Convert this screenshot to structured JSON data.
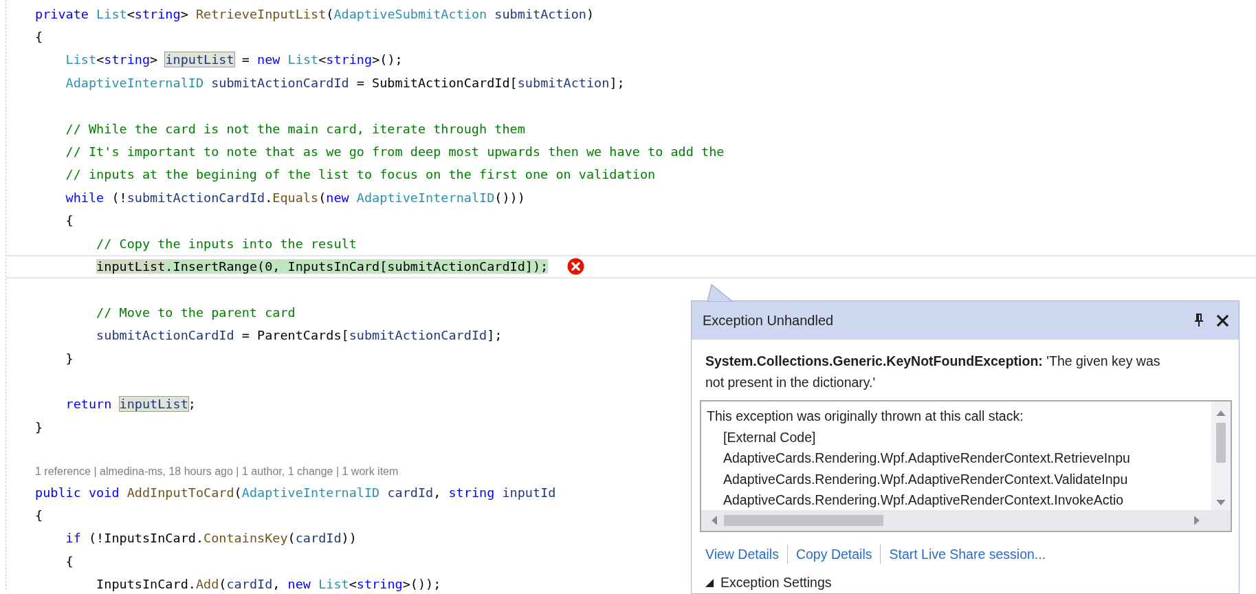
{
  "editor": {
    "blocks": [
      {
        "lines": [
          {
            "kind": "code",
            "current": false,
            "tokens": [
              {
                "text": "private ",
                "kind": "keyword"
              },
              {
                "text": "List",
                "kind": "type"
              },
              {
                "text": "<",
                "kind": "plain"
              },
              {
                "text": "string",
                "kind": "keyword"
              },
              {
                "text": "> ",
                "kind": "plain"
              },
              {
                "text": "RetrieveInputList",
                "kind": "method"
              },
              {
                "text": "(",
                "kind": "plain"
              },
              {
                "text": "AdaptiveSubmitAction ",
                "kind": "type"
              },
              {
                "text": "submitAction",
                "kind": "variable"
              },
              {
                "text": ")",
                "kind": "plain"
              }
            ]
          },
          {
            "kind": "code",
            "current": false,
            "tokens": [
              {
                "text": "{",
                "kind": "plain"
              }
            ]
          },
          {
            "kind": "code",
            "current": false,
            "tokens": [
              {
                "text": "    List",
                "kind": "type"
              },
              {
                "text": "<",
                "kind": "plain"
              },
              {
                "text": "string",
                "kind": "keyword"
              },
              {
                "text": "> ",
                "kind": "plain"
              },
              {
                "text": "inputList",
                "kind": "reference"
              },
              {
                "text": " = ",
                "kind": "plain"
              },
              {
                "text": "new ",
                "kind": "keyword"
              },
              {
                "text": "List",
                "kind": "type"
              },
              {
                "text": "<",
                "kind": "plain"
              },
              {
                "text": "string",
                "kind": "keyword"
              },
              {
                "text": ">();",
                "kind": "plain"
              }
            ]
          },
          {
            "kind": "code",
            "current": false,
            "tokens": [
              {
                "text": "    AdaptiveInternalID ",
                "kind": "type"
              },
              {
                "text": "submitActionCardId",
                "kind": "variable"
              },
              {
                "text": " = SubmitActionCardId[",
                "kind": "plain"
              },
              {
                "text": "submitAction",
                "kind": "variable"
              },
              {
                "text": "];",
                "kind": "plain"
              }
            ]
          }
        ]
      },
      {
        "lines": [
          {
            "kind": "code",
            "current": false,
            "tokens": [
              {
                "text": "    // While the card is not the main card, iterate through them",
                "kind": "comment"
              }
            ]
          },
          {
            "kind": "code",
            "current": false,
            "tokens": [
              {
                "text": "    // It's important to note that as we go from deep most upwards then we have to add the",
                "kind": "comment"
              }
            ]
          },
          {
            "kind": "code",
            "current": false,
            "tokens": [
              {
                "text": "    // inputs at the begining of the list to focus on the first one on validation",
                "kind": "comment"
              }
            ]
          },
          {
            "kind": "code",
            "current": false,
            "tokens": [
              {
                "text": "    while",
                "kind": "keyword"
              },
              {
                "text": " (!",
                "kind": "plain"
              },
              {
                "text": "submitActionCardId",
                "kind": "variable"
              },
              {
                "text": ".",
                "kind": "plain"
              },
              {
                "text": "Equals",
                "kind": "method"
              },
              {
                "text": "(",
                "kind": "plain"
              },
              {
                "text": "new ",
                "kind": "keyword"
              },
              {
                "text": "AdaptiveInternalID",
                "kind": "type"
              },
              {
                "text": "()))",
                "kind": "plain"
              }
            ]
          },
          {
            "kind": "code",
            "current": false,
            "tokens": [
              {
                "text": "    {",
                "kind": "plain"
              }
            ]
          },
          {
            "kind": "code",
            "current": false,
            "tokens": [
              {
                "text": "        // Copy the inputs into the result",
                "kind": "comment"
              }
            ]
          },
          {
            "kind": "error",
            "current": true,
            "tokens": [
              {
                "text": "        inputList",
                "kind": "statement_reference"
              },
              {
                "text": ".InsertRange(0, InputsInCard[submitActionCardId]);",
                "kind": "statement"
              }
            ]
          }
        ]
      },
      {
        "lines": [
          {
            "kind": "code",
            "current": false,
            "tokens": [
              {
                "text": "        // Move to the parent card",
                "kind": "comment"
              }
            ]
          },
          {
            "kind": "code",
            "current": false,
            "tokens": [
              {
                "text": "        submitActionCardId",
                "kind": "variable"
              },
              {
                "text": " = ParentCards[",
                "kind": "plain"
              },
              {
                "text": "submitActionCardId",
                "kind": "variable"
              },
              {
                "text": "];",
                "kind": "plain"
              }
            ]
          },
          {
            "kind": "code",
            "current": false,
            "tokens": [
              {
                "text": "    }",
                "kind": "plain"
              }
            ]
          }
        ]
      },
      {
        "lines": [
          {
            "kind": "code",
            "current": false,
            "tokens": [
              {
                "text": "    return ",
                "kind": "keyword"
              },
              {
                "text": "inputList",
                "kind": "reference"
              },
              {
                "text": ";",
                "kind": "plain"
              }
            ]
          },
          {
            "kind": "code",
            "current": false,
            "tokens": [
              {
                "text": "}",
                "kind": "plain"
              }
            ]
          }
        ]
      },
      {
        "lines": [
          {
            "kind": "codelens",
            "current": false,
            "text": "1 reference | almedina-ms, 18 hours ago | 1 author, 1 change | 1 work item"
          },
          {
            "kind": "code",
            "current": false,
            "tokens": [
              {
                "text": "public ",
                "kind": "keyword"
              },
              {
                "text": "void ",
                "kind": "keyword"
              },
              {
                "text": "AddInputToCard",
                "kind": "method"
              },
              {
                "text": "(",
                "kind": "plain"
              },
              {
                "text": "AdaptiveInternalID ",
                "kind": "type"
              },
              {
                "text": "cardId",
                "kind": "variable"
              },
              {
                "text": ", ",
                "kind": "plain"
              },
              {
                "text": "string ",
                "kind": "keyword"
              },
              {
                "text": "inputId",
                "kind": "variable"
              }
            ]
          },
          {
            "kind": "code",
            "current": false,
            "tokens": [
              {
                "text": "{",
                "kind": "plain"
              }
            ]
          },
          {
            "kind": "code",
            "current": false,
            "tokens": [
              {
                "text": "    if",
                "kind": "keyword"
              },
              {
                "text": " (!InputsInCard.",
                "kind": "plain"
              },
              {
                "text": "ContainsKey",
                "kind": "method"
              },
              {
                "text": "(",
                "kind": "plain"
              },
              {
                "text": "cardId",
                "kind": "variable"
              },
              {
                "text": "))",
                "kind": "plain"
              }
            ]
          },
          {
            "kind": "code",
            "current": false,
            "tokens": [
              {
                "text": "    {",
                "kind": "plain"
              }
            ]
          },
          {
            "kind": "code",
            "current": false,
            "tokens": [
              {
                "text": "        InputsInCard.",
                "kind": "plain"
              },
              {
                "text": "Add",
                "kind": "method"
              },
              {
                "text": "(",
                "kind": "plain"
              },
              {
                "text": "cardId",
                "kind": "variable"
              },
              {
                "text": ", ",
                "kind": "plain"
              },
              {
                "text": "new ",
                "kind": "keyword"
              },
              {
                "text": "List",
                "kind": "type"
              },
              {
                "text": "<",
                "kind": "plain"
              },
              {
                "text": "string",
                "kind": "keyword"
              },
              {
                "text": ">());",
                "kind": "plain"
              }
            ]
          }
        ]
      }
    ]
  },
  "exception_popup": {
    "title": "Exception Unhandled",
    "message": "**System.Collections.Generic.KeyNotFoundException:** 'The given key was not present in the dictionary.'",
    "call_stack": [
      {
        "text": "This exception was originally thrown at this call stack:",
        "kind": "heading"
      },
      {
        "text": "[External Code]",
        "kind": "frame"
      },
      {
        "text": "AdaptiveCards.Rendering.Wpf.AdaptiveRenderContext.RetrieveInpu",
        "kind": "frame"
      },
      {
        "text": "AdaptiveCards.Rendering.Wpf.AdaptiveRenderContext.ValidateInpu",
        "kind": "frame"
      },
      {
        "text": "AdaptiveCards.Rendering.Wpf.AdaptiveRenderContext.InvokeActio",
        "kind": "frame"
      }
    ],
    "links": [
      "View Details",
      "Copy Details",
      "Start Live Share session..."
    ],
    "settings": {
      "label": "Exception Settings",
      "expanded": true
    }
  }
}
